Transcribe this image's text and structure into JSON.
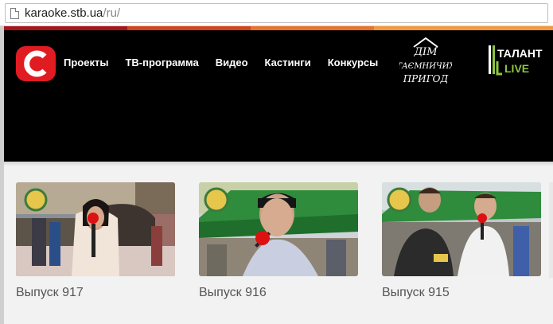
{
  "browser": {
    "url_host": "karaoke.stb.ua",
    "url_path": "/ru/"
  },
  "header": {
    "logo_letter": "C",
    "nav": [
      "Проекты",
      "ТВ-программа",
      "Видео",
      "Кастинги",
      "Конкурсы"
    ],
    "promo_1": {
      "lines": [
        "ДІМ",
        "ТАЄМНИЧИХ",
        "ПРИГОД"
      ]
    },
    "promo_2": {
      "line1": "ТАЛАНТ",
      "line2": "LIVE"
    },
    "colors": {
      "logo_red": "#e11b22",
      "talant_green": "#8cc63f"
    }
  },
  "episodes": [
    {
      "title": "Выпуск 917"
    },
    {
      "title": "Выпуск 916"
    },
    {
      "title": "Выпуск 915"
    }
  ]
}
